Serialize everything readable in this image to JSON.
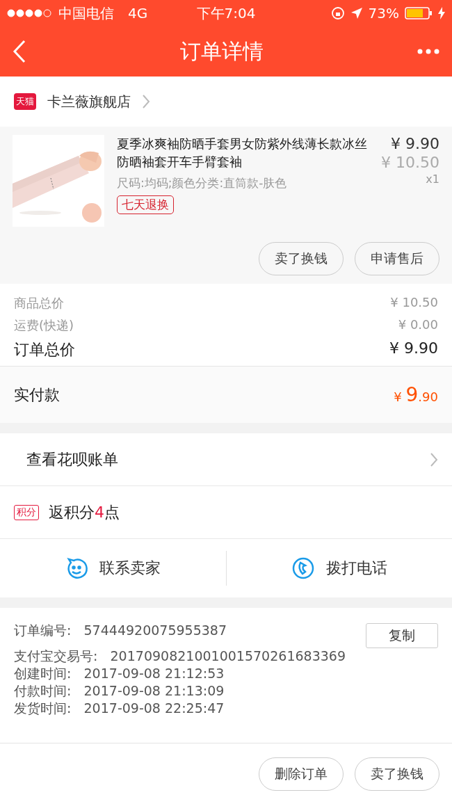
{
  "status_bar": {
    "carrier": "中国电信",
    "network": "4G",
    "time": "下午7:04",
    "battery": "73%"
  },
  "nav": {
    "title": "订单详情"
  },
  "shop": {
    "badge": "天猫",
    "name": "卡兰薇旗舰店"
  },
  "product": {
    "image": {
      "kind": "picture"
    },
    "title": "夏季冰爽袖防晒手套男女防紫外线薄长款冰丝防晒袖套开车手臂套袖",
    "price": "¥ 9.90",
    "original_price": "¥ 10.50",
    "quantity": "x1",
    "spec": "尺码:均码;颜色分类:直筒款-肤色",
    "tag": "七天退换",
    "buttons": [
      "卖了换钱",
      "申请售后"
    ]
  },
  "summary": {
    "rows": [
      {
        "label": "商品总价",
        "value": "¥ 10.50",
        "emphasis": false
      },
      {
        "label": "运费(快递)",
        "value": "¥ 0.00",
        "emphasis": false
      },
      {
        "label": "订单总价",
        "value": "¥ 9.90",
        "emphasis": true
      }
    ],
    "paid": {
      "label": "实付款",
      "currency": "¥ ",
      "integer": "9",
      "decimal": ".90"
    }
  },
  "huabei": {
    "label": "查看花呗账单"
  },
  "points": {
    "badge": "积分",
    "before": "返积分",
    "count": "4",
    "after": "点"
  },
  "contact": {
    "buttons": [
      {
        "kind": "chat",
        "label": "联系卖家"
      },
      {
        "kind": "phone",
        "label": "拨打电话"
      }
    ]
  },
  "order_info": {
    "copy_button": "复制",
    "rows": [
      {
        "label": "订单编号:",
        "value": "57444920075955387"
      },
      {
        "label": "支付宝交易号:",
        "value": "2017090821001001570261683369"
      },
      {
        "label": "创建时间:",
        "value": "2017-09-08 21:12:53"
      },
      {
        "label": "付款时间:",
        "value": "2017-09-08 21:13:09"
      },
      {
        "label": "发货时间:",
        "value": "2017-09-08 22:25:47"
      }
    ]
  },
  "footer": {
    "buttons": [
      "删除订单",
      "卖了换钱"
    ]
  }
}
